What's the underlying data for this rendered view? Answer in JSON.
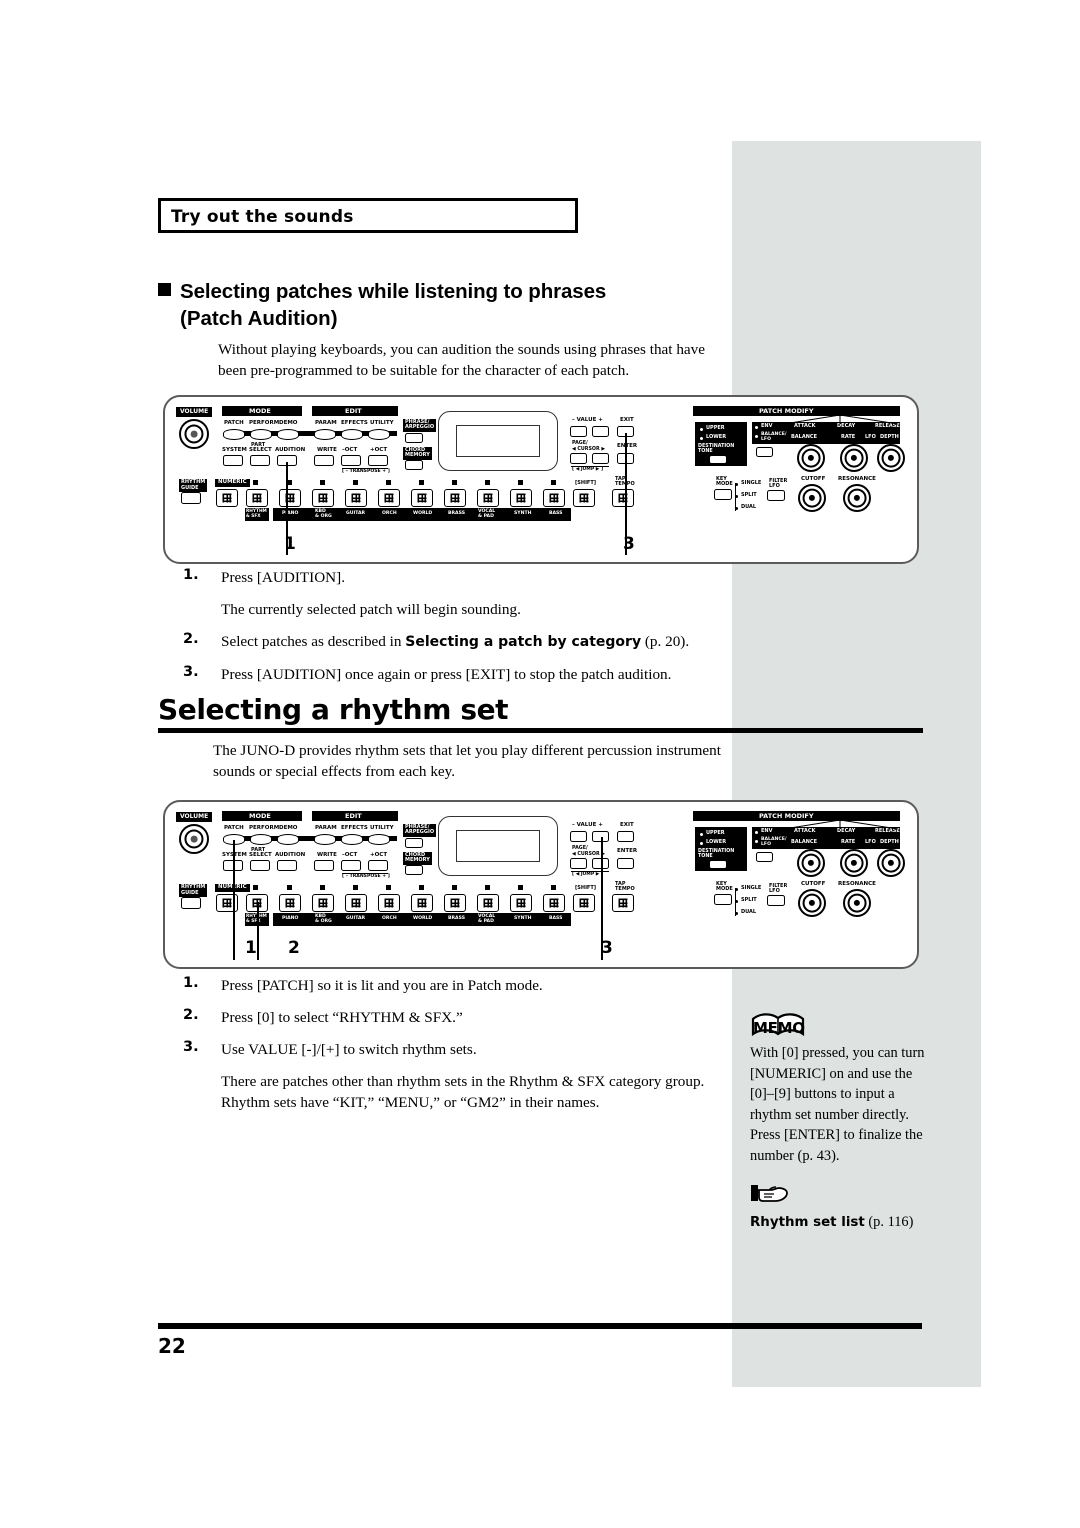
{
  "page": {
    "folio": "22",
    "running_head": "Try out the sounds"
  },
  "section_audition": {
    "heading_line1": "Selecting patches while listening to phrases",
    "heading_line2": "(Patch Audition)",
    "lead": "Without playing keyboards, you can audition the sounds using phrases that have been pre-programmed to be suitable for the character of each patch.",
    "steps": [
      {
        "num": "1.",
        "text": "Press [AUDITION]."
      },
      {
        "sub": "The currently selected patch will begin sounding."
      },
      {
        "num": "2.",
        "text_pre": "Select patches as described in ",
        "text_bold": "Selecting a patch by category",
        "text_post": " (p. 20)."
      },
      {
        "num": "3.",
        "text": "Press [AUDITION] once again or press [EXIT] to stop the patch audition."
      }
    ]
  },
  "section_rhythm": {
    "heading": "Selecting a rhythm set",
    "lead": "The JUNO-D provides rhythm sets that let you play different percussion instrument sounds or special effects from each key.",
    "steps": [
      {
        "num": "1.",
        "text": "Press [PATCH] so it is lit and you are in Patch mode."
      },
      {
        "num": "2.",
        "text": "Press [0] to select “RHYTHM & SFX.”"
      },
      {
        "num": "3.",
        "text": "Use VALUE [-]/[+] to switch rhythm sets."
      },
      {
        "sub": "There are patches other than rhythm sets in the Rhythm & SFX category group. Rhythm sets have “KIT,” “MENU,” or “GM2” in their names."
      }
    ]
  },
  "memo": {
    "label": "MEMO",
    "body": "With [0] pressed, you can turn [NUMERIC] on and use the [0]–[9] buttons to input a rhythm set number directly. Press [ENTER] to finalize the number (p. 43)."
  },
  "reference": {
    "title": "Rhythm set list",
    "page": " (p. 116)"
  },
  "panel": {
    "volume_label": "VOLUME",
    "mode_label": "MODE",
    "edit_label": "EDIT",
    "mode_buttons": [
      "PATCH",
      "PERFORM",
      "DEMO"
    ],
    "edit_buttons": [
      "PARAM",
      "EFFECTS",
      "UTILITY"
    ],
    "row2_left": [
      "SYSTEM",
      "PART SELECT",
      "AUDITION"
    ],
    "row2_edit": [
      "WRITE",
      "–OCT",
      "+OCT"
    ],
    "transpose_label": "[ – TRANSPOSE + ]",
    "phrase_label": "PHRASE/ ARPEGGIO",
    "chord_label": "CHORD MEMORY",
    "value_label": "–  VALUE  +",
    "exit_label": "EXIT",
    "cursor_label": "PAGE/ ◀ CURSOR ▶",
    "enter_label": "ENTER",
    "jump_label": "[ ◀ JUMP ▶ ]",
    "rhythm_guide_label": "RHYTHM GUIDE",
    "numeric_label": "NUMERIC",
    "shift_label": "[SHIFT]",
    "tap_tempo_label": "TAP TEMPO",
    "category_numbers": [
      "0",
      "1",
      "2",
      "3",
      "4",
      "5",
      "6",
      "7",
      "8",
      "9"
    ],
    "category_names": [
      "RHYTHM & SFX",
      "PIANO",
      "KBD & ORG",
      "GUITAR",
      "ORCH",
      "WORLD",
      "BRASS",
      "VOCAL & PAD",
      "SYNTH",
      "BASS"
    ],
    "patch_modify_label": "PATCH MODIFY",
    "destination_label": "DESTINATION TONE",
    "destination_leds": [
      "UPPER",
      "LOWER"
    ],
    "env_label": "ENV",
    "balance_lfo_label": "BALANCE/ LFO",
    "knob_labels_top": [
      "ATTACK",
      "DECAY",
      "RELEASE"
    ],
    "knob_labels_sub": [
      "BALANCE",
      "RATE",
      "LFO",
      "DEPTH"
    ],
    "cutoff_label": "CUTOFF",
    "resonance_label": "RESONANCE",
    "key_mode_label": "KEY MODE",
    "key_modes": [
      "SINGLE",
      "SPLIT",
      "DUAL"
    ],
    "filter_lfo_label": "FILTER LFO"
  },
  "callouts": {
    "diagram1": [
      "1",
      "3"
    ],
    "diagram2": [
      "1",
      "2",
      "3"
    ]
  },
  "colors": {
    "grey_band": "#dee2e1",
    "ink": "#000000",
    "panel_border": "#5b5b5b"
  }
}
